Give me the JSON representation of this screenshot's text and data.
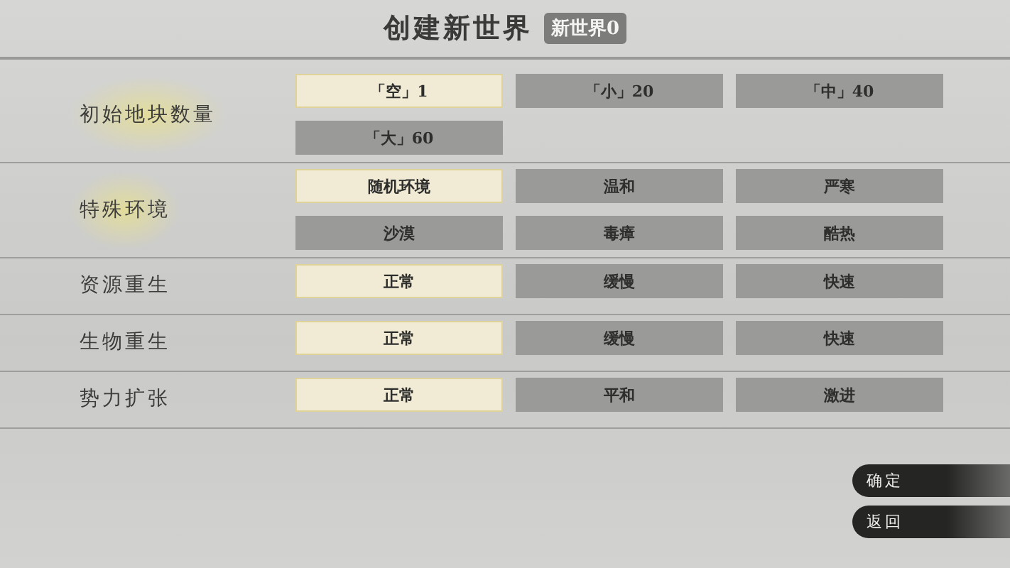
{
  "title": "创建新世界",
  "world_name": "新世界0",
  "settings": [
    {
      "label": "初始地块数量",
      "highlighted": true,
      "options": [
        {
          "label": "「空」1",
          "selected": true
        },
        {
          "label": "「小」20",
          "selected": false
        },
        {
          "label": "「中」40",
          "selected": false
        },
        {
          "label": "「大」60",
          "selected": false
        }
      ]
    },
    {
      "label": "特殊环境",
      "highlighted": true,
      "options": [
        {
          "label": "随机环境",
          "selected": true
        },
        {
          "label": "温和",
          "selected": false
        },
        {
          "label": "严寒",
          "selected": false
        },
        {
          "label": "沙漠",
          "selected": false
        },
        {
          "label": "毒瘴",
          "selected": false
        },
        {
          "label": "酷热",
          "selected": false
        }
      ]
    },
    {
      "label": "资源重生",
      "highlighted": false,
      "options": [
        {
          "label": "正常",
          "selected": true
        },
        {
          "label": "缓慢",
          "selected": false
        },
        {
          "label": "快速",
          "selected": false
        }
      ]
    },
    {
      "label": "生物重生",
      "highlighted": false,
      "options": [
        {
          "label": "正常",
          "selected": true
        },
        {
          "label": "缓慢",
          "selected": false
        },
        {
          "label": "快速",
          "selected": false
        }
      ]
    },
    {
      "label": "势力扩张",
      "highlighted": false,
      "options": [
        {
          "label": "正常",
          "selected": true
        },
        {
          "label": "平和",
          "selected": false
        },
        {
          "label": "激进",
          "selected": false
        }
      ]
    }
  ],
  "buttons": [
    "确定",
    "返回"
  ]
}
